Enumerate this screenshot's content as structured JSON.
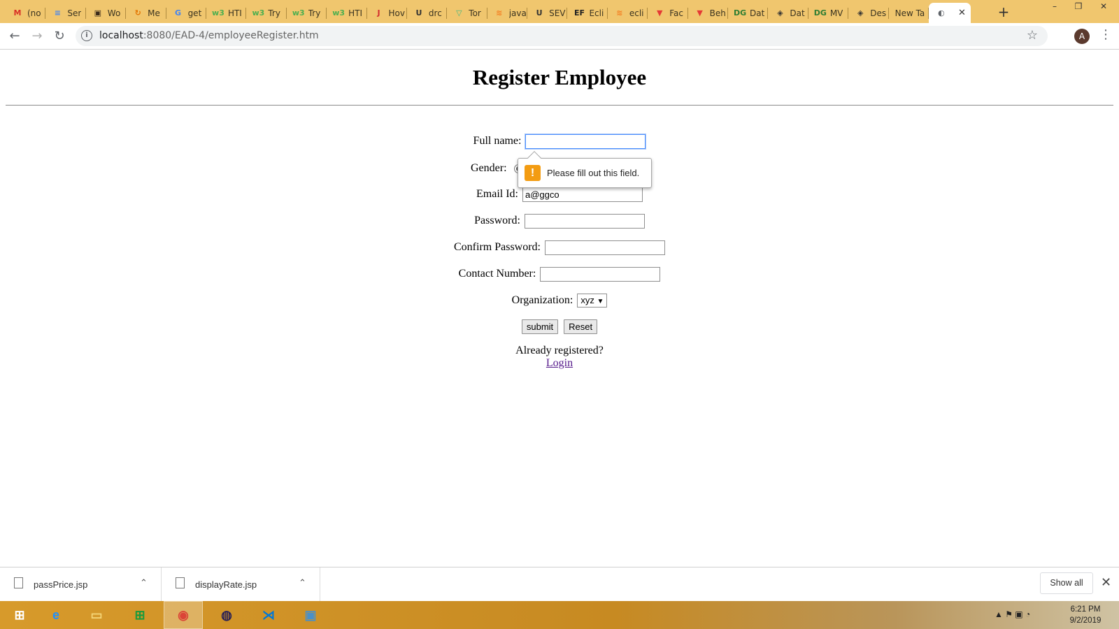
{
  "browser": {
    "tabs": [
      {
        "title": "(no",
        "icon": "gmail-icon",
        "color": "#d93025",
        "glyph": "M"
      },
      {
        "title": "Ser",
        "icon": "docs-icon",
        "color": "#4285f4",
        "glyph": "≡"
      },
      {
        "title": "Wo",
        "icon": "book-icon",
        "color": "#3a2a1a",
        "glyph": "▣"
      },
      {
        "title": "Me",
        "icon": "refresh-site-icon",
        "color": "#e37400",
        "glyph": "↻"
      },
      {
        "title": "get",
        "icon": "google-icon",
        "color": "#4285f4",
        "glyph": "G"
      },
      {
        "title": "HTI",
        "icon": "w3schools-icon",
        "color": "#4caf50",
        "glyph": "w3"
      },
      {
        "title": "Try",
        "icon": "w3schools-icon",
        "color": "#4caf50",
        "glyph": "w3"
      },
      {
        "title": "Try",
        "icon": "w3schools-icon",
        "color": "#4caf50",
        "glyph": "w3"
      },
      {
        "title": "HTI",
        "icon": "w3schools-icon",
        "color": "#4caf50",
        "glyph": "w3"
      },
      {
        "title": "Hov",
        "icon": "java-icon",
        "color": "#d32f2f",
        "glyph": "J"
      },
      {
        "title": "drc",
        "icon": "horseshoe-icon",
        "color": "#333333",
        "glyph": "U"
      },
      {
        "title": "Tor",
        "icon": "vue-icon",
        "color": "#41b883",
        "glyph": "▽"
      },
      {
        "title": "java",
        "icon": "stackoverflow-icon",
        "color": "#f48024",
        "glyph": "≋"
      },
      {
        "title": "SEV",
        "icon": "horseshoe-icon",
        "color": "#333333",
        "glyph": "U"
      },
      {
        "title": "Ecli",
        "icon": "ef-icon",
        "color": "#222222",
        "glyph": "EF"
      },
      {
        "title": "ecli",
        "icon": "stackoverflow-icon",
        "color": "#f48024",
        "glyph": "≋"
      },
      {
        "title": "Fac",
        "icon": "triangle-logo-icon",
        "color": "#e53935",
        "glyph": "▼"
      },
      {
        "title": "Beh",
        "icon": "triangle-logo-icon",
        "color": "#e53935",
        "glyph": "▼"
      },
      {
        "title": "Dat",
        "icon": "dg-icon",
        "color": "#2e7d32",
        "glyph": "DG"
      },
      {
        "title": "Dat",
        "icon": "diamond-icon",
        "color": "#333333",
        "glyph": "◈"
      },
      {
        "title": "MV",
        "icon": "dg-icon",
        "color": "#2e7d32",
        "glyph": "DG"
      },
      {
        "title": "Des",
        "icon": "diamond-icon",
        "color": "#333333",
        "glyph": "◈"
      },
      {
        "title": "New Ta",
        "icon": "none",
        "color": "#333333",
        "glyph": ""
      }
    ],
    "active_tab": {
      "icon": "globe-icon",
      "glyph": "◐",
      "close": "✕"
    },
    "new_tab": "+",
    "window": {
      "minimize": "–",
      "restore": "❐",
      "close": "✕"
    },
    "nav": {
      "back": "←",
      "forward": "→",
      "reload": "↻"
    },
    "url_host": "localhost",
    "url_rest": ":8080/EAD-4/employeeRegister.htm",
    "info_glyph": "i",
    "star": "☆",
    "avatar_letter": "A",
    "menu": "⋮"
  },
  "page": {
    "title": "Register Employee",
    "full_name_label": "Full name:",
    "full_name_value": "",
    "gender_label": "Gender:",
    "email_label": "Email Id:",
    "email_value": "a@ggco",
    "password_label": "Password:",
    "confirm_password_label": "Confirm Password:",
    "contact_label": "Contact Number:",
    "organization_label": "Organization:",
    "organization_value": "xyz",
    "select_arrow": "▼",
    "submit_label": "submit",
    "reset_label": "Reset",
    "already_registered": "Already registered?",
    "login_link": "Login",
    "validation": {
      "glyph": "!",
      "message": "Please fill out this field."
    }
  },
  "downloads": {
    "items": [
      {
        "name": "passPrice.jsp",
        "chevron": "⌃"
      },
      {
        "name": "displayRate.jsp",
        "chevron": "⌃"
      }
    ],
    "show_all": "Show all",
    "close": "✕"
  },
  "taskbar": {
    "apps": [
      {
        "icon": "windows-start-icon",
        "glyph": "⊞",
        "color": "#ffffff"
      },
      {
        "icon": "internet-explorer-icon",
        "glyph": "e",
        "color": "#1e90ff"
      },
      {
        "icon": "file-explorer-icon",
        "glyph": "▭",
        "color": "#f5d77a"
      },
      {
        "icon": "store-icon",
        "glyph": "⊞",
        "color": "#1a9b3c"
      },
      {
        "icon": "chrome-icon",
        "glyph": "◉",
        "color": "#db4437"
      },
      {
        "icon": "eclipse-icon",
        "glyph": "◍",
        "color": "#2c2255"
      },
      {
        "icon": "vscode-icon",
        "glyph": "⋊",
        "color": "#0078d7"
      },
      {
        "icon": "remote-desktop-icon",
        "glyph": "▣",
        "color": "#4a90c8"
      }
    ],
    "tray": "▲  ⚑  ▣  ◔",
    "time": "6:21 PM",
    "date": "9/2/2019"
  }
}
